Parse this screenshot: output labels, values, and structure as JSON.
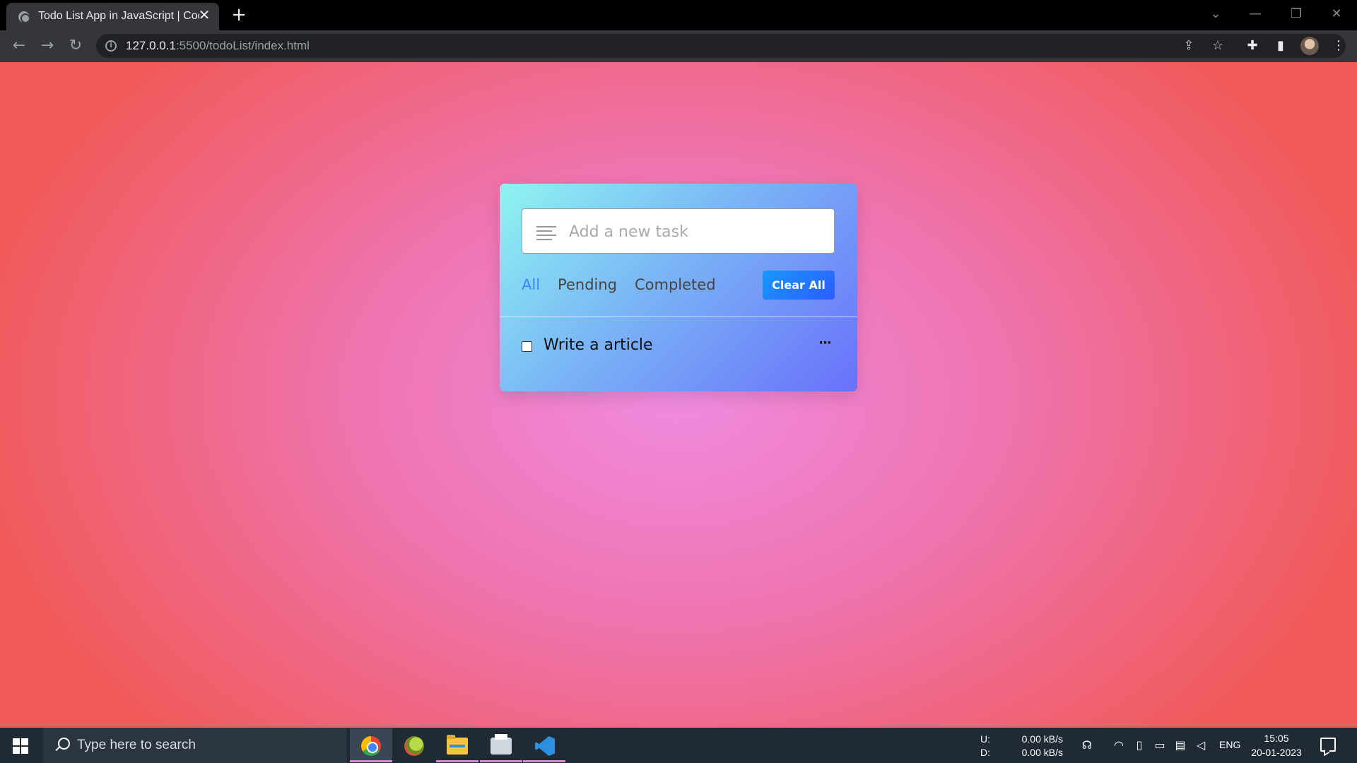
{
  "browser": {
    "tab_title": "Todo List App in JavaScript | Codi",
    "tab_close": "✕",
    "new_tab": "+",
    "url_host": "127.0.0.1",
    "url_path": ":5500/todoList/index.html",
    "info_symbol": "i",
    "controls": {
      "dropdown": "⌄",
      "minimize": "—",
      "restore": "❐",
      "close": "✕"
    }
  },
  "app": {
    "input_placeholder": "Add a new task",
    "filters": [
      "All",
      "Pending",
      "Completed"
    ],
    "active_filter": "All",
    "clear_all_label": "Clear All",
    "tasks": [
      {
        "text": "Write a article",
        "completed": false,
        "menu": "···"
      }
    ],
    "accent_color": "#3c87ff"
  },
  "taskbar": {
    "search_placeholder": "Type here to search",
    "apps": [
      "chrome",
      "chameleon",
      "file-explorer",
      "printer",
      "vscode"
    ],
    "net_upload_label": "U:",
    "net_download_label": "D:",
    "net_upload_value": "0.00 kB/s",
    "net_download_value": "0.00 kB/s",
    "language": "ENG",
    "time": "15:05",
    "date": "20-01-2023"
  }
}
